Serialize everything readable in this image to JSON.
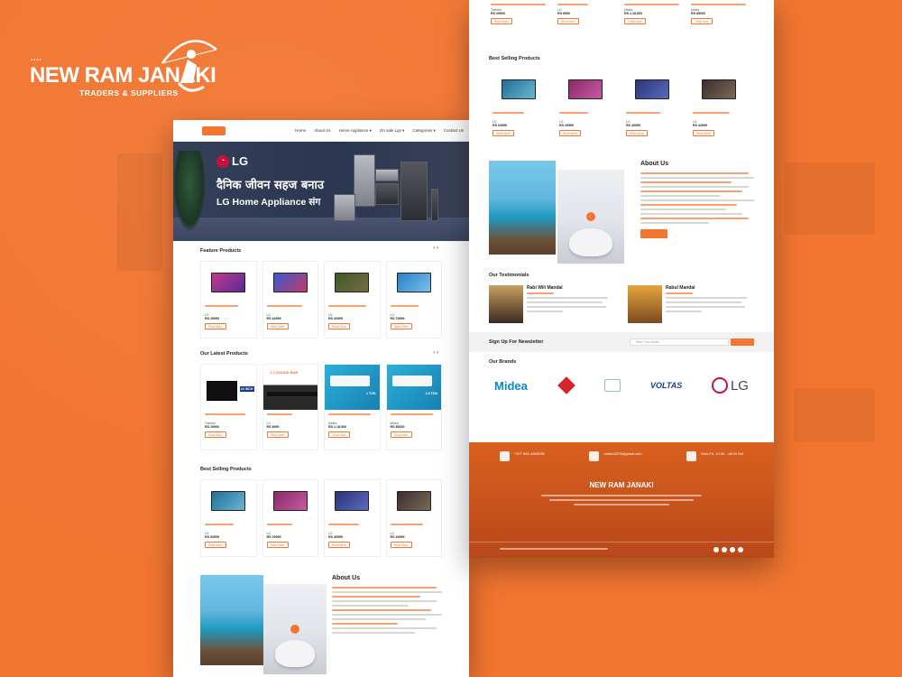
{
  "brand": {
    "title": "NEW RAM JANAKI",
    "subtitle": "TRADERS & SUPPLIERS"
  },
  "nav": [
    "Home",
    "About Us",
    "Home Appliance ▾",
    "On sale Lgs ▾",
    "Categories ▾",
    "Contact Us"
  ],
  "hero": {
    "brand": "LG",
    "tagline_devanagari": "दैनिक जीवन सहज बनाउ",
    "tagline_en": "LG Home Appliance संग"
  },
  "featured": {
    "title": "Feature Products",
    "arrows": "‹ ›",
    "items": [
      {
        "brand": "LG",
        "price": "RS 29999",
        "button": "Read More",
        "screen": "#8a2a8a"
      },
      {
        "brand": "LG",
        "price": "RS 44999",
        "button": "Read More",
        "screen": "#2d3c9a"
      },
      {
        "brand": "LG",
        "price": "RS 40999",
        "button": "Read More",
        "screen": "#3c5a2a"
      },
      {
        "brand": "LG",
        "price": "RS 79999",
        "button": "Read More",
        "screen": "#2a7fc8"
      }
    ]
  },
  "latest": {
    "title": "Our Latest Products",
    "arrows": "‹ ›",
    "items": [
      {
        "brand": "Toshiba",
        "price": "RS 29900",
        "button": "Read More",
        "badge": "24 INCH"
      },
      {
        "brand": "LG",
        "price": "RS 8990",
        "button": "Read More",
        "badge": "2.1 SOUND BAR"
      },
      {
        "brand": "Midea",
        "price": "RS 1,18,500",
        "button": "Shop Now",
        "badge": "1 TON"
      },
      {
        "brand": "Midea",
        "price": "RS 85000",
        "button": "Shop Now",
        "badge": "1.5 TON"
      }
    ]
  },
  "bestselling": {
    "title": "Best Selling Products",
    "items": [
      {
        "brand": "LG",
        "price": "RS 54999",
        "button": "Read More",
        "screen": "#1f6f9a"
      },
      {
        "brand": "LG",
        "price": "RS 29999",
        "button": "Read More",
        "screen": "#8a2a6a"
      },
      {
        "brand": "LG",
        "price": "RS 40999",
        "button": "Read More",
        "screen": "#2a3478"
      },
      {
        "brand": "LG",
        "price": "RS 44999",
        "button": "Read More",
        "screen": "#3b2f2a"
      }
    ]
  },
  "right_top_items": [
    {
      "brand": "Toshiba",
      "price": "RS 29900",
      "button": "Read More"
    },
    {
      "brand": "LG",
      "price": "RS 8990",
      "button": "Read More"
    },
    {
      "brand": "Midea",
      "price": "RS 1,18,500",
      "button": "Shop Now"
    },
    {
      "brand": "Midea",
      "price": "RS 85000",
      "button": "Shop Now"
    }
  ],
  "about": {
    "title": "About Us"
  },
  "testimonials": {
    "title": "Our Testimonials",
    "items": [
      {
        "name": "Rabi Wili Mandal"
      },
      {
        "name": "Rabul Mandal"
      }
    ]
  },
  "newsletter": {
    "title": "Sign Up For Newsletter",
    "placeholder": "Enter Your Email"
  },
  "brands_section": {
    "title": "Our Brands",
    "midea": "Midea",
    "voltas": "VOLTAS",
    "lg": "LG"
  },
  "footer": {
    "phone": "+977 981-4809336",
    "email": "nrtsho2373@gmail.com",
    "hours": "Mon-Fri, 10:00 - 18:00 Sat",
    "logo": "NEW RAM JANAKI"
  }
}
